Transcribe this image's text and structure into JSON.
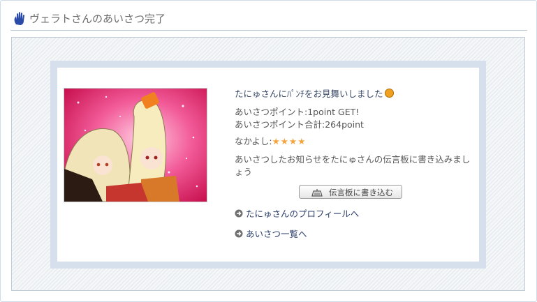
{
  "header": {
    "title": "ヴェラトさんのあいさつ完了",
    "icon": "hand-icon"
  },
  "greeting": {
    "message": "たにゅさんにﾊﾟﾝﾁをお見舞いしました",
    "points_line": "あいさつポイント:1point GET!",
    "total_line": "あいさつポイント合計:264point",
    "friendship_label": "なかよし:",
    "friendship_stars": "★★★★",
    "friendship_level": 4,
    "notice": "あいさつしたお知らせをたにゅさんの伝言板に書き込みましょう"
  },
  "actions": {
    "board_button_label": "伝言板に書き込む",
    "profile_link": "たにゅさんのプロフィールへ",
    "list_link": "あいさつ一覧へ"
  },
  "colors": {
    "accent_blue": "#2c3f6b",
    "panel_blue": "#d5e0ec",
    "star": "#f2a33a",
    "hand": "#2a4aa8"
  }
}
